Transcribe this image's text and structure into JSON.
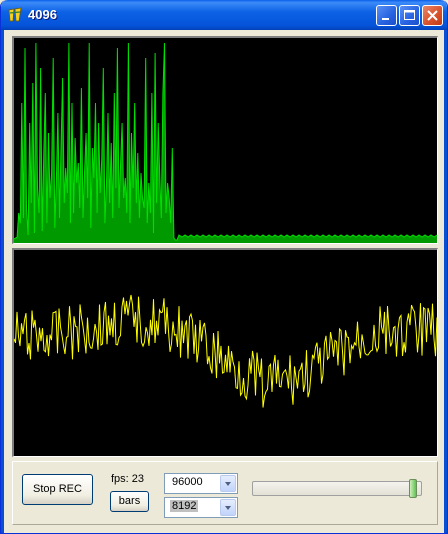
{
  "window": {
    "title": "4096",
    "icon": "app-icon-yellow-script",
    "controls": [
      "minimize-icon",
      "maximize-icon",
      "close-icon"
    ]
  },
  "spectrum": {
    "color": "#00E000",
    "bars": [
      4,
      5,
      6,
      30,
      20,
      140,
      25,
      195,
      35,
      8,
      120,
      40,
      160,
      10,
      200,
      55,
      30,
      175,
      12,
      90,
      150,
      20,
      110,
      45,
      70,
      185,
      15,
      60,
      130,
      25,
      95,
      165,
      40,
      75,
      50,
      200,
      20,
      140,
      30,
      105,
      60,
      80,
      35,
      155,
      25,
      70,
      110,
      45,
      200,
      15,
      95,
      65,
      140,
      30,
      120,
      50,
      85,
      175,
      20,
      60,
      130,
      40,
      100,
      25,
      150,
      55,
      195,
      35,
      80,
      120,
      45,
      65,
      30,
      200,
      20,
      110,
      55,
      140,
      40,
      90,
      25,
      70,
      45,
      35,
      185,
      20,
      60,
      30,
      150,
      10,
      190,
      40,
      120,
      65,
      25,
      150,
      200,
      30,
      60,
      45,
      20,
      95,
      5,
      3,
      3
    ],
    "flat_level": 6
  },
  "waveform": {
    "color": "#FFFF00",
    "seed": 4096
  },
  "controls": {
    "stop_rec_label": "Stop REC",
    "fps_label": "fps: 23",
    "bars_label": "bars",
    "sample_rate_value": "96000",
    "fft_size_value": "8192",
    "slider_value": 0.97
  }
}
